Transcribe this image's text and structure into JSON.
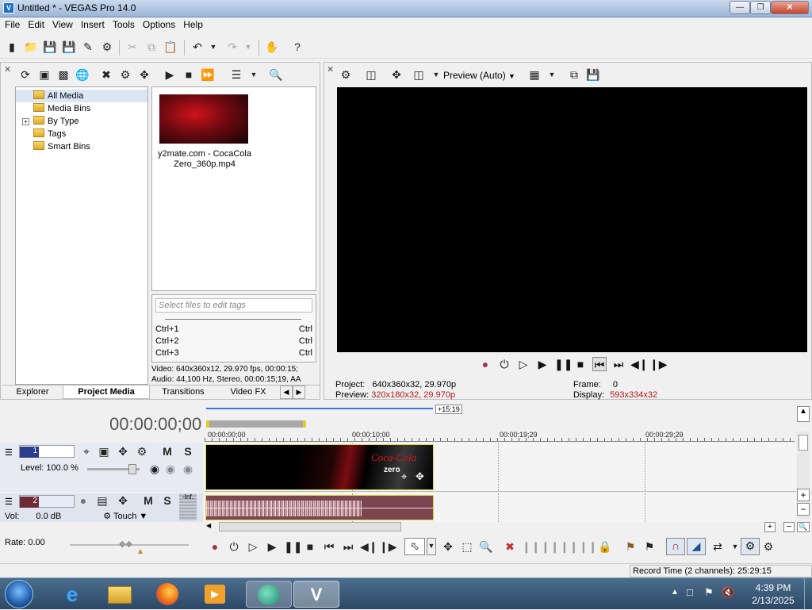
{
  "window": {
    "title": "Untitled * - VEGAS Pro 14.0",
    "app_icon": "vegas-icon"
  },
  "menu": [
    "File",
    "Edit",
    "View",
    "Insert",
    "Tools",
    "Options",
    "Help"
  ],
  "explorer": {
    "tree": [
      {
        "label": "All Media",
        "expander": ""
      },
      {
        "label": "Media Bins",
        "expander": ""
      },
      {
        "label": "By Type",
        "expander": "+"
      },
      {
        "label": "Tags",
        "expander": ""
      },
      {
        "label": "Smart Bins",
        "expander": ""
      }
    ],
    "media_item": {
      "name_line1": "y2mate.com - CocaCola",
      "name_line2": "Zero_360p.mp4"
    },
    "tags": {
      "placeholder": "Select files to edit tags",
      "shortcuts": [
        {
          "key": "Ctrl+1",
          "action": "Ctrl"
        },
        {
          "key": "Ctrl+2",
          "action": "Ctrl"
        },
        {
          "key": "Ctrl+3",
          "action": "Ctrl"
        }
      ]
    },
    "info_video": "Video: 640x360x12, 29.970 fps, 00:00:15;",
    "info_audio": "Audio: 44,100 Hz, Stereo, 00:00:15;19, AA",
    "tabs": [
      "Explorer",
      "Project Media",
      "Transitions",
      "Video FX"
    ]
  },
  "preview": {
    "mode": "Preview (Auto)",
    "project_label": "Project:",
    "project_value": "640x360x32, 29.970p",
    "preview_label": "Preview:",
    "preview_value": "320x180x32, 29.970p",
    "frame_label": "Frame:",
    "frame_value": "0",
    "display_label": "Display:",
    "display_value": "593x334x32"
  },
  "timeline": {
    "timecode": "00:00:00;00",
    "loop_end": "+15:19",
    "ruler": [
      "00:00:00;00",
      "00:00:10;00",
      "00:00:19;29",
      "00:00:29;29"
    ],
    "track1": {
      "number": "1",
      "level_label": "Level: 100.0 %",
      "mute": "M",
      "solo": "S"
    },
    "track2": {
      "number": "2",
      "vol_label": "Vol:",
      "vol_value": "0.0 dB",
      "touch": "Touch",
      "mute": "M",
      "solo": "S",
      "meter": "-Inf."
    },
    "clip_logo": "Coca-Cola",
    "clip_sub": "zero"
  },
  "transport": {
    "rate": "Rate: 0.00"
  },
  "status": {
    "record_time": "Record Time (2 channels): 25:29:15"
  },
  "taskbar": {
    "time": "4:39 PM",
    "date": "2/13/2025",
    "apps": [
      "start-orb-icon",
      "internet-explorer-icon",
      "file-explorer-icon",
      "firefox-icon",
      "media-player-icon",
      "app-icon",
      "vegas-icon"
    ]
  }
}
